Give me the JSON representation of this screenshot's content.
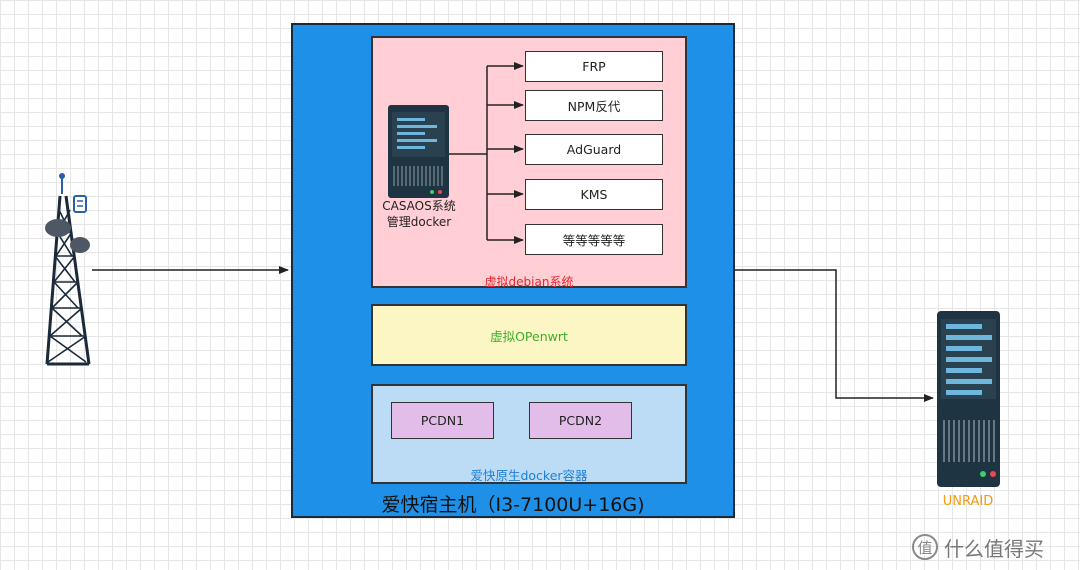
{
  "host": {
    "title": "爱快宿主机（I3-7100U+16G)",
    "debian": {
      "label": "虚拟debian系统",
      "server_caption_line1": "CASAOS系统",
      "server_caption_line2": "管理docker",
      "services": [
        "FRP",
        "NPM反代",
        "AdGuard",
        "KMS",
        "等等等等等"
      ]
    },
    "openwrt": {
      "label": "虚拟OPenwrt"
    },
    "aikuai": {
      "label": "爱快原生docker容器",
      "pcdn": [
        "PCDN1",
        "PCDN2"
      ]
    }
  },
  "unraid": {
    "label": "UNRAID"
  },
  "watermark": {
    "logo_glyph": "值",
    "text": "什么值得买"
  },
  "icons": [
    "cell-tower-icon",
    "server-icon"
  ],
  "colors": {
    "host": "#1e90e8",
    "debian": "#ffcfd5",
    "openwrt": "#fbf6c3",
    "aikuai": "#bcdcf5",
    "pcdn": "#e3bdea",
    "debian_label": "#e8242a",
    "openwrt_label": "#3fae2a",
    "aikuai_label": "#1d7fd9",
    "unraid_label": "#f29a0c"
  }
}
